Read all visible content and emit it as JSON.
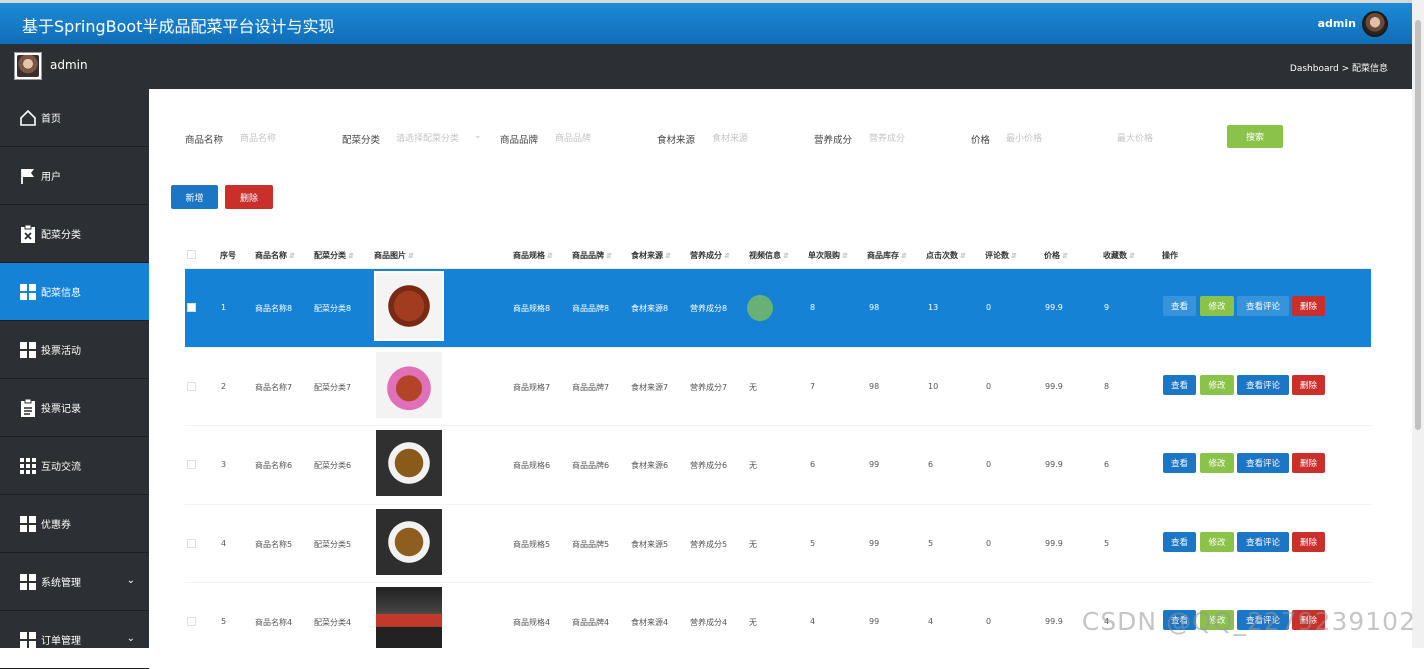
{
  "app": {
    "title": "基于SpringBoot半成品配菜平台设计与实现",
    "top_user": "admin",
    "sub_user": "admin",
    "breadcrumb": "Dashboard > 配菜信息"
  },
  "sidebar": {
    "items": [
      {
        "label": "首页",
        "icon": "home-icon"
      },
      {
        "label": "用户",
        "icon": "flag-icon"
      },
      {
        "label": "配菜分类",
        "icon": "clipboard-x-icon"
      },
      {
        "label": "配菜信息",
        "icon": "grid-icon",
        "active": true
      },
      {
        "label": "投票活动",
        "icon": "grid-icon"
      },
      {
        "label": "投票记录",
        "icon": "clipboard-icon"
      },
      {
        "label": "互动交流",
        "icon": "grid9-icon"
      },
      {
        "label": "优惠券",
        "icon": "grid-icon"
      },
      {
        "label": "系统管理",
        "icon": "grid-icon",
        "chevron": true
      },
      {
        "label": "订单管理",
        "icon": "grid-icon",
        "chevron": true
      }
    ]
  },
  "filters": {
    "name_label": "商品名称",
    "name_placeholder": "商品名称",
    "category_label": "配菜分类",
    "category_placeholder": "请选择配菜分类",
    "brand_label": "商品品牌",
    "brand_placeholder": "商品品牌",
    "source_label": "食材来源",
    "source_placeholder": "食材来源",
    "nutrition_label": "营养成分",
    "nutrition_placeholder": "营养成分",
    "price_label": "价格",
    "price_min_placeholder": "最小价格",
    "price_max_placeholder": "最大价格",
    "search_label": "搜索"
  },
  "toolbar": {
    "add_label": "新增",
    "delete_label": "删除"
  },
  "table": {
    "columns": [
      "序号",
      "商品名称",
      "配菜分类",
      "商品图片",
      "商品规格",
      "商品品牌",
      "食材来源",
      "营养成分",
      "视频信息",
      "单次限购",
      "商品库存",
      "点击次数",
      "评论数",
      "价格",
      "收藏数",
      "操作"
    ],
    "actions": {
      "view": "查看",
      "edit": "修改",
      "comments": "查看评论",
      "delete": "删除"
    },
    "rows": [
      {
        "idx": "1",
        "name": "商品名称8",
        "cat": "配菜分类8",
        "spec": "商品规格8",
        "brand": "商品品牌8",
        "src": "食材来源8",
        "nut": "营养成分8",
        "video": "",
        "limit": "8",
        "stock": "98",
        "clicks": "13",
        "comments": "0",
        "price": "99.9",
        "favs": "9",
        "selected": true
      },
      {
        "idx": "2",
        "name": "商品名称7",
        "cat": "配菜分类7",
        "spec": "商品规格7",
        "brand": "商品品牌7",
        "src": "食材来源7",
        "nut": "营养成分7",
        "video": "无",
        "limit": "7",
        "stock": "98",
        "clicks": "10",
        "comments": "0",
        "price": "99.9",
        "favs": "8"
      },
      {
        "idx": "3",
        "name": "商品名称6",
        "cat": "配菜分类6",
        "spec": "商品规格6",
        "brand": "商品品牌6",
        "src": "食材来源6",
        "nut": "营养成分6",
        "video": "无",
        "limit": "6",
        "stock": "99",
        "clicks": "6",
        "comments": "0",
        "price": "99.9",
        "favs": "6"
      },
      {
        "idx": "4",
        "name": "商品名称5",
        "cat": "配菜分类5",
        "spec": "商品规格5",
        "brand": "商品品牌5",
        "src": "食材来源5",
        "nut": "营养成分5",
        "video": "无",
        "limit": "5",
        "stock": "99",
        "clicks": "5",
        "comments": "0",
        "price": "99.9",
        "favs": "5"
      },
      {
        "idx": "5",
        "name": "商品名称4",
        "cat": "配菜分类4",
        "spec": "商品规格4",
        "brand": "商品品牌4",
        "src": "食材来源4",
        "nut": "营养成分4",
        "video": "无",
        "limit": "4",
        "stock": "99",
        "clicks": "4",
        "comments": "0",
        "price": "99.9",
        "favs": "4"
      }
    ]
  },
  "watermark": "CSDN @QQ_2279239102",
  "colors": {
    "brand_blue": "#1582d6",
    "sidebar": "#2c2f33",
    "search_green": "#8bc34a",
    "delete_red": "#c9302c"
  }
}
